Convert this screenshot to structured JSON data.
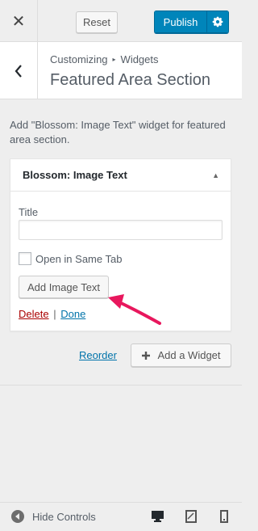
{
  "header": {
    "close_symbol": "✕",
    "reset_label": "Reset",
    "publish_label": "Publish"
  },
  "section": {
    "breadcrumb_parent": "Customizing",
    "breadcrumb_separator": "▸",
    "breadcrumb_current": "Widgets",
    "title": "Featured Area Section"
  },
  "description": "Add \"Blossom: Image Text\" widget for featured area section.",
  "widget": {
    "title": "Blossom: Image Text",
    "toggle_symbol": "▲",
    "field_label": "Title",
    "title_value": "",
    "checkbox_label": "Open in Same Tab",
    "add_image_label": "Add Image Text",
    "delete_label": "Delete",
    "separator": "|",
    "done_label": "Done"
  },
  "widgets_actions": {
    "reorder_label": "Reorder",
    "add_widget_label": "Add a Widget"
  },
  "footer": {
    "hide_controls_label": "Hide Controls"
  },
  "colors": {
    "accent": "#0085ba",
    "annotation_arrow": "#e8175d",
    "link": "#0073aa",
    "delete": "#aa0000"
  },
  "icons": [
    "close-icon",
    "gear-icon",
    "back-chevron-icon",
    "plus-icon",
    "collapse-arrow-icon",
    "desktop-icon",
    "tablet-icon",
    "mobile-icon"
  ]
}
